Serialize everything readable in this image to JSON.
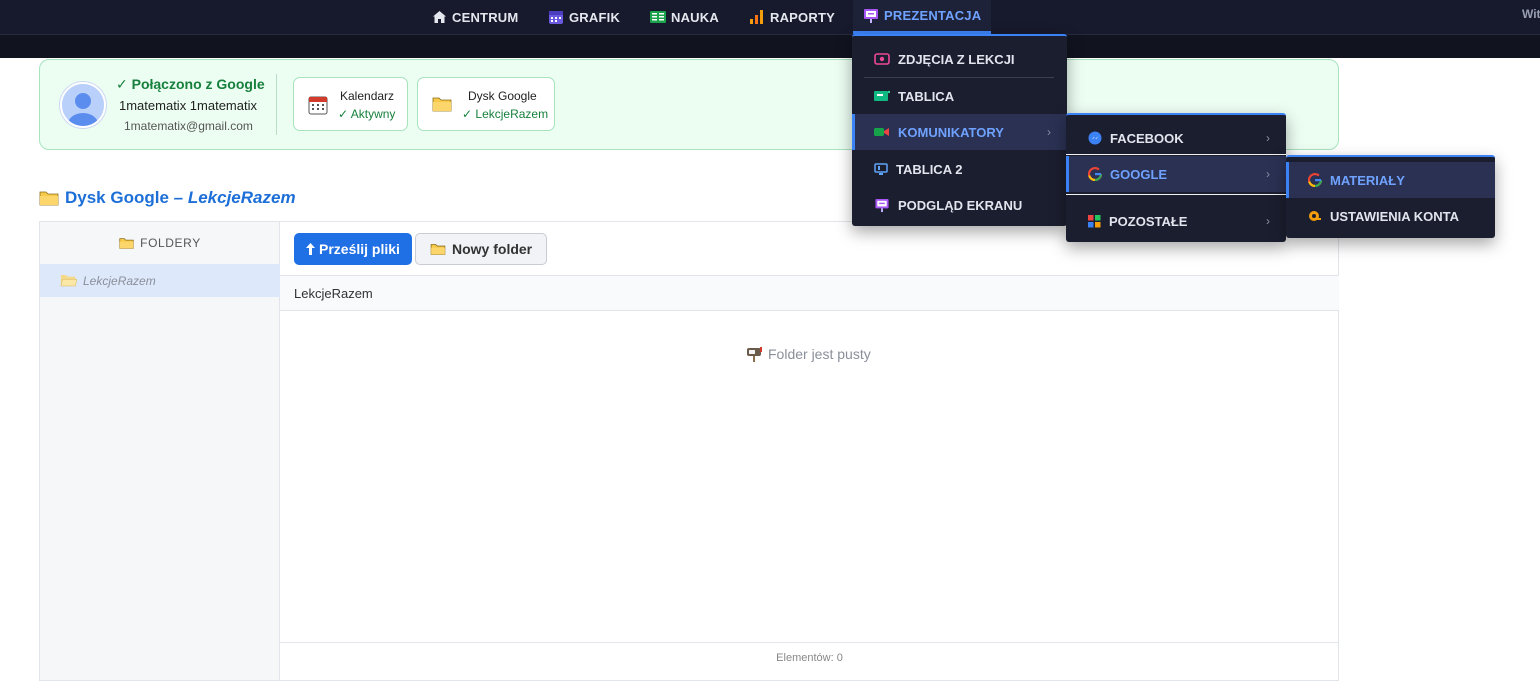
{
  "nav": {
    "items": [
      {
        "label": "CENTRUM",
        "icon": "home-icon"
      },
      {
        "label": "GRAFIK",
        "icon": "calendar-icon"
      },
      {
        "label": "NAUKA",
        "icon": "notebook-icon"
      },
      {
        "label": "RAPORTY",
        "icon": "bar-chart-icon"
      },
      {
        "label": "PREZENTACJA",
        "icon": "presentation-icon",
        "active": true
      }
    ],
    "right_cut": "Wit"
  },
  "google": {
    "status": "✓ Połączono z Google",
    "name": "1matematix 1matematix",
    "email": "1matematix@gmail.com",
    "services": [
      {
        "title": "Kalendarz",
        "status": "✓ Aktywny"
      },
      {
        "title": "Dysk Google",
        "status": "✓ LekcjeRazem"
      }
    ]
  },
  "section": {
    "prefix": "Dysk Google – ",
    "folder": "LekcjeRazem"
  },
  "sidebar": {
    "header": "FOLDERY",
    "folders": [
      "LekcjeRazem"
    ]
  },
  "toolbar": {
    "upload": "Prześlij pliki",
    "new_folder": "Nowy folder"
  },
  "path": "LekcjeRazem",
  "empty_text": "Folder jest pusty",
  "footer": "Elementów: 0",
  "menu1": {
    "items": [
      "ZDJĘCIA Z LEKCJI",
      "TABLICA",
      "KOMUNIKATORY",
      "TABLICA 2",
      "PODGLĄD EKRANU"
    ]
  },
  "menu2": {
    "items": [
      "FACEBOOK",
      "GOOGLE",
      "POZOSTAŁE"
    ]
  },
  "menu3": {
    "items": [
      "MATERIAŁY",
      "USTAWIENIA KONTA"
    ]
  },
  "colors": {
    "accent": "#3b82f6",
    "nav_bg": "#171a2c",
    "success": "#17803d",
    "primary_button": "#1f6fe5"
  }
}
